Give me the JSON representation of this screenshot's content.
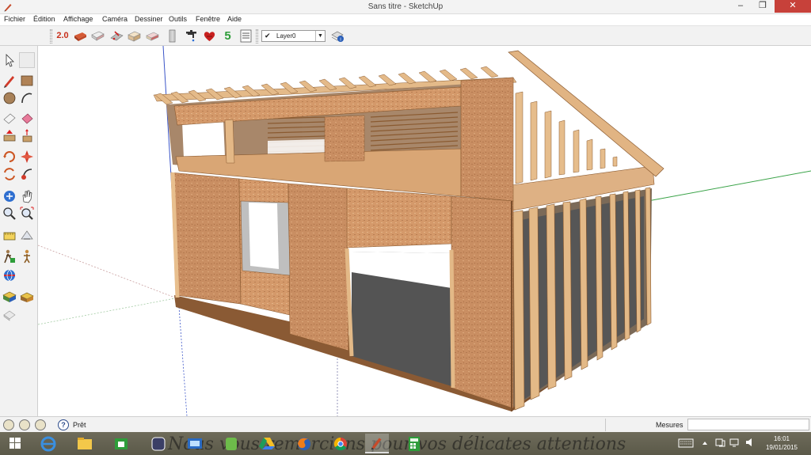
{
  "window": {
    "title": "Sans titre - SketchUp",
    "minimize_glyph": "–",
    "maximize_glyph": "❐",
    "close_glyph": "✕"
  },
  "menu": {
    "items": [
      "Fichier",
      "Édition",
      "Affichage",
      "Caméra",
      "Dessiner",
      "Outils",
      "Fenêtre",
      "Aide"
    ]
  },
  "toolbar": {
    "version_label": "2.0",
    "level_label": "5",
    "layer": {
      "check": "✔",
      "name": "Layer0",
      "dropdown_glyph": "▼"
    },
    "icons": [
      "warehouse-2-icon",
      "brick-icon",
      "eraser-box-icon",
      "roof-icon",
      "box-icon",
      "shingle-icon",
      "column-icon",
      "faucet-icon",
      "heart-icon",
      "level-5-icon",
      "list-icon",
      "layer-manager-icon"
    ]
  },
  "palette": {
    "icons": [
      "select-icon",
      "pencil-icon",
      "rectangle-icon",
      "circle-icon",
      "arc-icon",
      "eraser-icon",
      "paint-bucket-icon",
      "push-pull-icon",
      "move-icon",
      "rotate-icon",
      "offset-icon",
      "orbit-icon",
      "pan-icon",
      "zoom-icon",
      "zoom-extents-icon",
      "tape-measure-icon",
      "dimension-icon",
      "walk-icon",
      "look-around-icon",
      "position-camera-icon",
      "section-plane-icon",
      "get-models-icon",
      "share-model-icon",
      "warehouse-icon"
    ]
  },
  "status": {
    "text": "Prêt",
    "help_glyph": "?",
    "measures_label": "Mesures",
    "measures_value": ""
  },
  "taskbar": {
    "watermark": "Nous vous remercions pour vos délicates attentions",
    "apps": [
      "windows-start-icon",
      "internet-explorer-icon",
      "file-explorer-icon",
      "store-icon",
      "app-icon",
      "photo-viewer-icon",
      "android-icon",
      "google-drive-icon",
      "firefox-icon",
      "chrome-icon",
      "sketchup-icon",
      "calculator-icon"
    ],
    "time": "16:01",
    "date": "19/01/2015"
  },
  "colors": {
    "osb": "#c98e62",
    "osb_dark": "#b47a50",
    "timber": "#e3b987",
    "timber_dark": "#b88552",
    "axis_green": "#3aa348",
    "axis_blue": "#3c56c8",
    "floor": "#5b5b5b"
  }
}
